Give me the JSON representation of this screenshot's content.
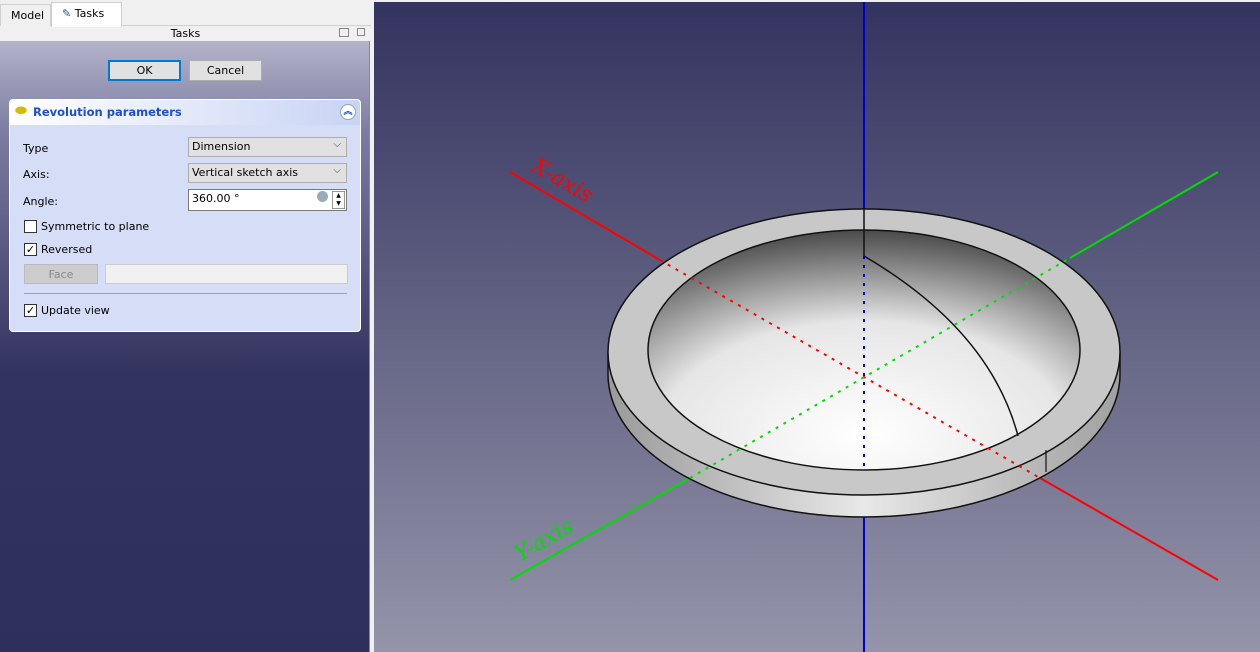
{
  "tabs": [
    {
      "label": "Model"
    },
    {
      "label": "Tasks"
    }
  ],
  "panel_title": "Tasks",
  "buttons": {
    "ok": "OK",
    "cancel": "Cancel"
  },
  "revolution": {
    "title": "Revolution parameters",
    "type_label": "Type",
    "type_value": "Dimension",
    "axis_label": "Axis:",
    "axis_value": "Vertical sketch axis",
    "angle_label": "Angle:",
    "angle_value": "360.00 °",
    "symmetric_label": "Symmetric to plane",
    "symmetric_checked": false,
    "reversed_label": "Reversed",
    "reversed_checked": true,
    "face_button": "Face",
    "face_value": "",
    "update_view_label": "Update view",
    "update_view_checked": true
  },
  "viewport": {
    "x_axis_label": "X-axis",
    "y_axis_label": "Y-axis",
    "colors": {
      "x": "#ff0000",
      "y": "#00dd00",
      "z": "#0000cc"
    }
  }
}
